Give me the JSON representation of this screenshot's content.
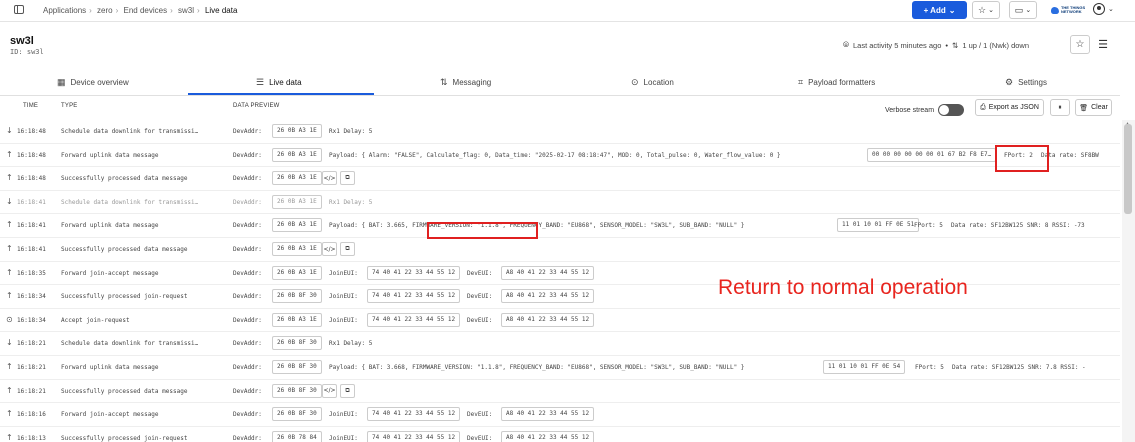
{
  "breadcrumb": [
    "Applications",
    "zero",
    "End devices",
    "sw3l",
    "Live data"
  ],
  "header_actions": {
    "add_label": "+ Add",
    "star": "☆",
    "inbox": "▭",
    "logo_text": "THE THINGS NETWORK"
  },
  "device": {
    "name": "sw3l",
    "id": "ID: sw3l",
    "last_activity": "Last activity 5 minutes ago",
    "frame_counts": "1 up / 1 (Nwk) down"
  },
  "tabs": [
    {
      "label": "Device overview",
      "icon": "grid-icon"
    },
    {
      "label": "Live data",
      "icon": "list-icon"
    },
    {
      "label": "Messaging",
      "icon": "arrows-icon"
    },
    {
      "label": "Location",
      "icon": "pin-icon"
    },
    {
      "label": "Payload formatters",
      "icon": "code-icon"
    },
    {
      "label": "Settings",
      "icon": "gear-icon"
    }
  ],
  "table": {
    "col_time": "TIME",
    "col_type": "TYPE",
    "col_preview": "DATA PREVIEW",
    "verbose_label": "Verbose stream",
    "export_label": "Export as JSON",
    "pause_label": "",
    "clear_label": "Clear"
  },
  "rows": [
    {
      "dir": "↓",
      "time": "16:18:48",
      "type": "Schedule data downlink for transmissi…",
      "addr_label": "DevAddr:",
      "addr": "26 0B A3 1E",
      "preview": "Rx1 Delay: 5",
      "faded": false
    },
    {
      "dir": "↑",
      "time": "16:18:48",
      "type": "Forward uplink data message",
      "addr_label": "DevAddr:",
      "addr": "26 0B A3 1E",
      "preview": "Payload: { Alarm: \"FALSE\", Calculate_flag: 0, Data_time: \"2025-02-17 08:18:47\", MOD: 0, Total_pulse: 0, Water_flow_value: 0 }",
      "raw": "00 00 00 00 00 00 01 67 B2 F8 E7…",
      "fport": "FPort: 2",
      "extra": "Data rate: SF8BW",
      "faded": false
    },
    {
      "dir": "↑",
      "time": "16:18:48",
      "type": "Successfully processed data message",
      "addr_label": "DevAddr:",
      "addr": "26 0B A3 1E",
      "preview": "",
      "faded": false
    },
    {
      "dir": "↓",
      "time": "16:18:41",
      "type": "Schedule data downlink for transmissi…",
      "addr_label": "DevAddr:",
      "addr": "26 0B A3 1E",
      "preview": "Rx1 Delay: 5",
      "faded": true
    },
    {
      "dir": "↑",
      "time": "16:18:41",
      "type": "Forward uplink data message",
      "addr_label": "DevAddr:",
      "addr": "26 0B A3 1E",
      "preview": "Payload: { BAT: 3.665, FIRMWARE_VERSION: \"1.1.8\", FREQUENCY_BAND: \"EU868\", SENSOR_MODEL: \"SW3L\", SUB_BAND: \"NULL\" }",
      "raw": "11 01 10 01 FF 0E 51",
      "fport": "FPort: 5",
      "extra": "Data rate: SF12BW125  SNR: 8  RSSI: -73",
      "faded": false
    },
    {
      "dir": "↑",
      "time": "16:18:41",
      "type": "Successfully processed data message",
      "addr_label": "DevAddr:",
      "addr": "26 0B A3 1E",
      "preview": "",
      "faded": false
    },
    {
      "dir": "↑",
      "time": "16:18:35",
      "type": "Forward join-accept message",
      "addr_label": "DevAddr:",
      "addr": "26 0B A3 1E",
      "join_label": "JoinEUI:",
      "join": "74 40 41 22 33 44 55 12",
      "dev_label": "DevEUI:",
      "dev": "A8 40 41 22 33 44 55 12",
      "faded": false
    },
    {
      "dir": "↑",
      "time": "16:18:34",
      "type": "Successfully processed join-request",
      "addr_label": "DevAddr:",
      "addr": "26 0B 8F 30",
      "join_label": "JoinEUI:",
      "join": "74 40 41 22 33 44 55 12",
      "dev_label": "DevEUI:",
      "dev": "A8 40 41 22 33 44 55 12",
      "faded": false
    },
    {
      "dir": "⊙",
      "time": "16:18:34",
      "type": "Accept join-request",
      "addr_label": "DevAddr:",
      "addr": "26 0B A3 1E",
      "join_label": "JoinEUI:",
      "join": "74 40 41 22 33 44 55 12",
      "dev_label": "DevEUI:",
      "dev": "A8 40 41 22 33 44 55 12",
      "faded": false
    },
    {
      "dir": "↓",
      "time": "16:18:21",
      "type": "Schedule data downlink for transmissi…",
      "addr_label": "DevAddr:",
      "addr": "26 0B 8F 30",
      "preview": "Rx1 Delay: 5",
      "faded": false
    },
    {
      "dir": "↑",
      "time": "16:18:21",
      "type": "Forward uplink data message",
      "addr_label": "DevAddr:",
      "addr": "26 0B 8F 30",
      "preview": "Payload: { BAT: 3.668, FIRMWARE_VERSION: \"1.1.8\", FREQUENCY_BAND: \"EU868\", SENSOR_MODEL: \"SW3L\", SUB_BAND: \"NULL\" }",
      "raw": "11 01 10 01 FF 0E 54",
      "fport": "FPort: 5",
      "extra": "Data rate: SF12BW125  SNR: 7.8  RSSI: -",
      "faded": false
    },
    {
      "dir": "↑",
      "time": "16:18:21",
      "type": "Successfully processed data message",
      "addr_label": "DevAddr:",
      "addr": "26 0B 8F 30",
      "preview": "",
      "faded": false
    },
    {
      "dir": "↑",
      "time": "16:18:16",
      "type": "Forward join-accept message",
      "addr_label": "DevAddr:",
      "addr": "26 0B 8F 30",
      "join_label": "JoinEUI:",
      "join": "74 40 41 22 33 44 55 12",
      "dev_label": "DevEUI:",
      "dev": "A8 40 41 22 33 44 55 12",
      "faded": false
    },
    {
      "dir": "↑",
      "time": "16:18:13",
      "type": "Successfully processed join-request",
      "addr_label": "DevAddr:",
      "addr": "26 0B 78 84",
      "join_label": "JoinEUI:",
      "join": "74 40 41 22 33 44 55 12",
      "dev_label": "DevEUI:",
      "dev": "A8 40 41 22 33 44 55 12",
      "faded": false
    }
  ],
  "annotation_text": "Return to normal operation",
  "colors": {
    "accent": "#1a5bdc",
    "annotation": "#e8251f"
  }
}
